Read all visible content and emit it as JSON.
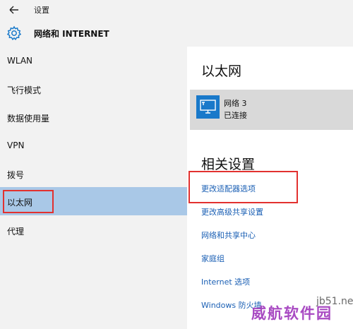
{
  "titlebar": {
    "back_icon": "arrow-left-icon",
    "title": "设置"
  },
  "header": {
    "icon": "gear-icon",
    "title": "网络和 INTERNET"
  },
  "sidebar": {
    "items": [
      {
        "label": "WLAN"
      },
      {
        "label": "飞行模式"
      },
      {
        "label": "数据使用量"
      },
      {
        "label": "VPN"
      },
      {
        "label": "拨号"
      },
      {
        "label": "以太网",
        "selected": true
      },
      {
        "label": "代理"
      }
    ]
  },
  "main": {
    "title": "以太网",
    "network": {
      "icon": "monitor-icon",
      "name": "网络  3",
      "status": "已连接"
    },
    "related_title": "相关设置",
    "links": [
      {
        "label": "更改适配器选项"
      },
      {
        "label": "更改高级共享设置"
      },
      {
        "label": "网络和共享中心"
      },
      {
        "label": "家庭组"
      },
      {
        "label": "Internet 选项"
      },
      {
        "label": "Windows 防火墙"
      }
    ]
  },
  "watermark": {
    "site": "jb51.net",
    "text": "威航软件园"
  },
  "colors": {
    "selected_bg": "#a9c8e7",
    "accent": "#1979ca",
    "link": "#1a5fb4",
    "highlight_box": "#e2312f"
  }
}
